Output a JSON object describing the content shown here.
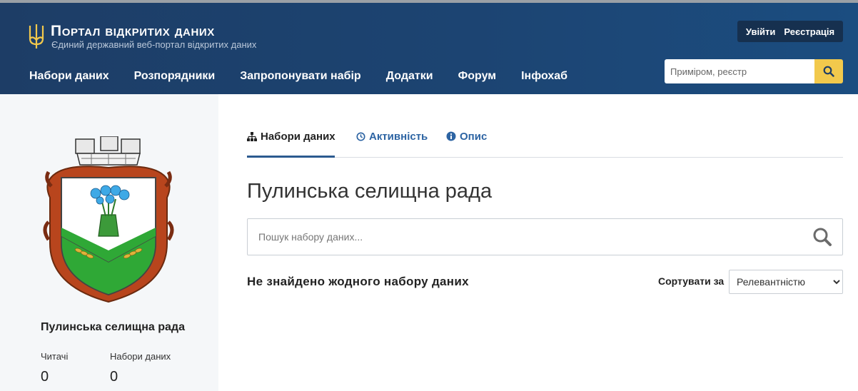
{
  "header": {
    "title": "Портал відкритих даних",
    "subtitle": "Єдиний державний веб-портал відкритих даних",
    "auth": {
      "login": "Увійти",
      "register": "Реєстрація"
    },
    "nav": [
      {
        "label": "Набори даних"
      },
      {
        "label": "Розпорядники"
      },
      {
        "label": "Запропонувати набір"
      },
      {
        "label": "Додатки"
      },
      {
        "label": "Форум"
      },
      {
        "label": "Інфохаб"
      }
    ],
    "search": {
      "placeholder": "Приміром, реєстр",
      "icon": "search-icon"
    }
  },
  "sidebar": {
    "org_name": "Пулинська селищна рада",
    "stats": [
      {
        "label": "Читачі",
        "value": "0"
      },
      {
        "label": "Набори даних",
        "value": "0"
      }
    ]
  },
  "tabs": [
    {
      "label": "Набори даних",
      "icon": "sitemap-icon",
      "active": true
    },
    {
      "label": "Активність",
      "icon": "clock-icon",
      "active": false
    },
    {
      "label": "Опис",
      "icon": "info-icon",
      "active": false
    }
  ],
  "main": {
    "title": "Пулинська селищна рада",
    "search_placeholder": "Пошук набору даних...",
    "no_results": "Не знайдено жодного набору даних",
    "sort_label": "Сортувати за",
    "sort_selected": "Релевантністю"
  },
  "colors": {
    "header_bg": "#1c4472",
    "accent_yellow": "#f2c94c",
    "link_blue": "#2d64a3",
    "sidebar_bg": "#f5f7f9"
  }
}
